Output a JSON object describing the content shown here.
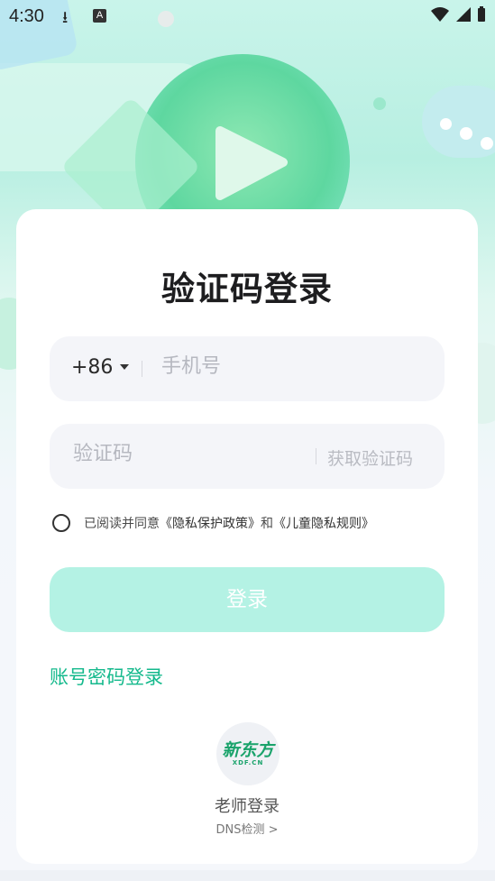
{
  "status_bar": {
    "time": "4:30"
  },
  "login": {
    "title": "验证码登录",
    "phone": {
      "country_code": "+86",
      "placeholder": "手机号"
    },
    "code": {
      "placeholder": "验证码",
      "get_code_label": "获取验证码"
    },
    "agreement": {
      "prefix": "已阅读并同意",
      "privacy_policy": "《隐私保护政策》",
      "and": "和",
      "children_rules": "《儿童隐私规则》"
    },
    "login_button": "登录",
    "password_login_link": "账号密码登录",
    "logo": {
      "main": "新东方",
      "sub": "XDF.CN"
    },
    "teacher_login": "老师登录",
    "dns_check": "DNS检测 >"
  },
  "colors": {
    "accent": "#14b98c",
    "button_disabled": "#b4f2e4",
    "field_bg": "#f4f5f9"
  }
}
